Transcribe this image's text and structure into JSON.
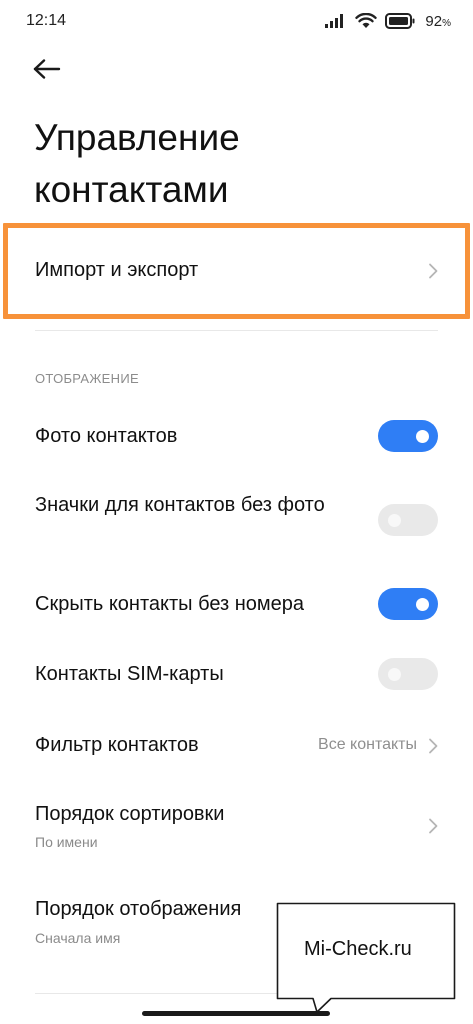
{
  "status_bar": {
    "time": "12:14",
    "battery_value": "92",
    "battery_unit": "%",
    "icons": [
      "signal-icon",
      "wifi-icon",
      "battery-icon"
    ]
  },
  "header": {
    "back_icon": "arrow-left-icon",
    "title_line1": "Управление",
    "title_line2": "контактами"
  },
  "import_export": {
    "label": "Импорт и экспорт",
    "highlight_color": "#f7923a"
  },
  "display_section": {
    "header": "ОТОБРАЖЕНИЕ",
    "items": [
      {
        "label": "Фото контактов",
        "type": "toggle",
        "on": true
      },
      {
        "label": "Значки для контактов без фото",
        "type": "toggle",
        "on": false
      },
      {
        "label": "Скрыть контакты без номера",
        "type": "toggle",
        "on": true
      },
      {
        "label": "Контакты SIM-карты",
        "type": "toggle",
        "on": false
      },
      {
        "label": "Фильтр контактов",
        "type": "link",
        "value": "Все контакты"
      },
      {
        "label": "Порядок сортировки",
        "type": "link",
        "subtitle": "По имени"
      },
      {
        "label": "Порядок отображения",
        "type": "link",
        "subtitle": "Сначала имя"
      }
    ]
  },
  "watermark": {
    "text": "Mi-Check.ru"
  },
  "colors": {
    "accent": "#2f7ef5",
    "toggle_off": "#e9e9e9",
    "highlight": "#f7923a"
  }
}
